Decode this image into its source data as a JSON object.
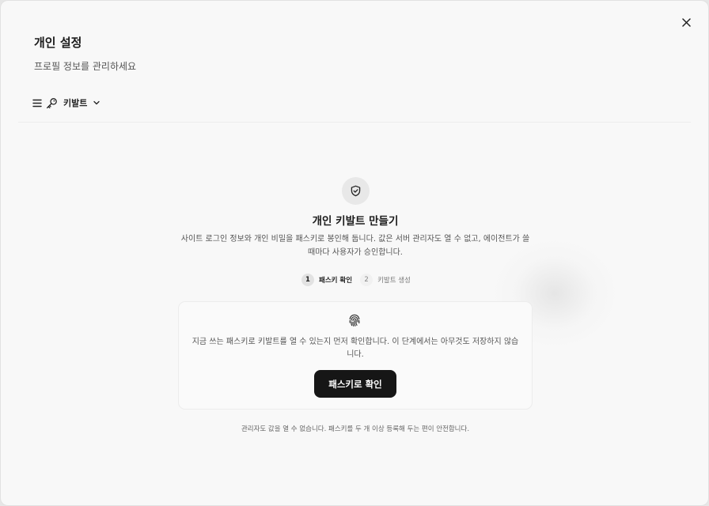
{
  "modal": {
    "title": "개인 설정",
    "subtitle": "프로필 정보를 관리하세요"
  },
  "toolbar": {
    "menu_icon": "menu-icon",
    "key_icon": "key-icon",
    "label": "키발트",
    "chevron_icon": "chevron-down-icon"
  },
  "hero": {
    "icon": "shield-check-icon",
    "title": "개인 키발트 만들기",
    "description": "사이트 로그인 정보와 개인 비밀을 패스키로 봉인해 둡니다. 값은 서버 관리자도 열 수 없고, 에이전트가 쓸 때마다 사용자가 승인합니다."
  },
  "steps": [
    {
      "number": "1",
      "label": "패스키 확인",
      "active": true
    },
    {
      "number": "2",
      "label": "키발트 생성",
      "active": false
    }
  ],
  "card": {
    "icon": "fingerprint-icon",
    "text": "지금 쓰는 패스키로 키발트를 열 수 있는지 먼저 확인합니다. 이 단계에서는 아무것도 저장하지 않습니다.",
    "button_label": "패스키로 확인"
  },
  "footnote": "관리자도 값을 열 수 없습니다. 패스키를 두 개 이상 등록해 두는 편이 안전합니다.",
  "colors": {
    "primary_button": "#161616",
    "background": "#f8f8f8"
  }
}
